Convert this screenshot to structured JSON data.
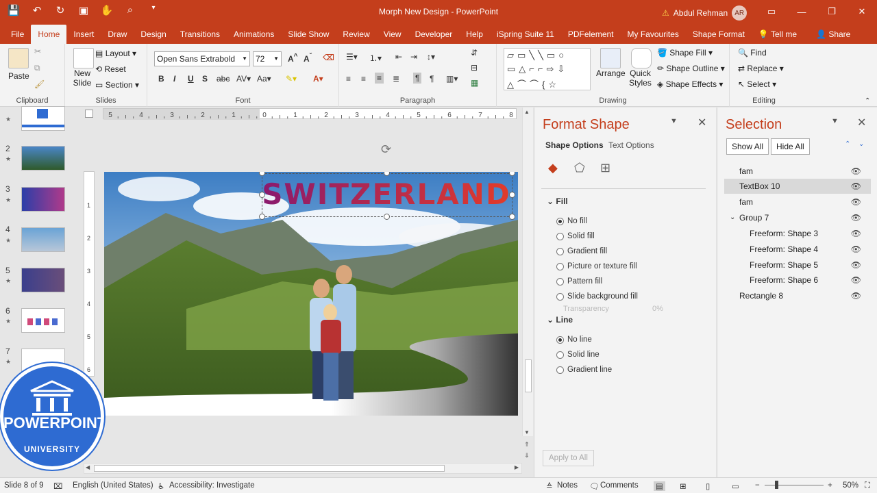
{
  "window": {
    "title": "Morph New Design  -  PowerPoint",
    "user_name": "Abdul Rehman",
    "user_initials": "AR"
  },
  "tabs": [
    "File",
    "Home",
    "Insert",
    "Draw",
    "Design",
    "Transitions",
    "Animations",
    "Slide Show",
    "Review",
    "View",
    "Developer",
    "Help",
    "iSpring Suite 11",
    "PDFelement",
    "My Favourites",
    "Shape Format"
  ],
  "tell_me": "Tell me",
  "share": "Share",
  "ribbon": {
    "clipboard": {
      "label": "Clipboard",
      "paste": "Paste"
    },
    "slides": {
      "label": "Slides",
      "new_slide": "New",
      "new_slide2": "Slide",
      "layout": "Layout",
      "reset": "Reset",
      "section": "Section"
    },
    "font": {
      "label": "Font",
      "family": "Open Sans Extrabold",
      "size": "72"
    },
    "paragraph": {
      "label": "Paragraph"
    },
    "drawing": {
      "label": "Drawing",
      "arrange": "Arrange",
      "quick_styles": "Quick",
      "quick_styles2": "Styles",
      "shape_fill": "Shape Fill",
      "shape_outline": "Shape Outline",
      "shape_effects": "Shape Effects"
    },
    "editing": {
      "label": "Editing",
      "find": "Find",
      "replace": "Replace",
      "select": "Select"
    }
  },
  "slides": [
    {
      "num": "",
      "star": "★"
    },
    {
      "num": "2",
      "star": "★"
    },
    {
      "num": "3",
      "star": "★"
    },
    {
      "num": "4",
      "star": "★"
    },
    {
      "num": "5",
      "star": "★"
    },
    {
      "num": "6",
      "star": "★"
    },
    {
      "num": "7",
      "star": "★"
    }
  ],
  "slide_content": {
    "headline": "SWITZERLAND"
  },
  "ruler": {
    "h_ticks": [
      "5",
      "4",
      "3",
      "2",
      "1",
      "0",
      "1",
      "2",
      "3",
      "4",
      "5",
      "6",
      "7",
      "8"
    ],
    "v_ticks": [
      "1",
      "2",
      "3",
      "4",
      "5",
      "6"
    ]
  },
  "format_pane": {
    "title": "Format Shape",
    "tab_shape": "Shape Options",
    "tab_text": "Text Options",
    "fill_head": "Fill",
    "fill_options": [
      "No fill",
      "Solid fill",
      "Gradient fill",
      "Picture or texture fill",
      "Pattern fill",
      "Slide background fill"
    ],
    "line_head": "Line",
    "line_options": [
      "No line",
      "Solid line",
      "Gradient line"
    ],
    "transparency": "Transparency",
    "transparency_value": "0%",
    "apply_all": "Apply to All"
  },
  "selection_pane": {
    "title": "Selection",
    "show_all": "Show All",
    "hide_all": "Hide All",
    "items": [
      {
        "label": "fam",
        "indent": 0,
        "selected": false
      },
      {
        "label": "TextBox 10",
        "indent": 0,
        "selected": true
      },
      {
        "label": "fam",
        "indent": 0,
        "selected": false
      },
      {
        "label": "Group 7",
        "indent": 0,
        "selected": false,
        "group": true
      },
      {
        "label": "Freeform: Shape 3",
        "indent": 1,
        "selected": false
      },
      {
        "label": "Freeform: Shape 4",
        "indent": 1,
        "selected": false
      },
      {
        "label": "Freeform: Shape 5",
        "indent": 1,
        "selected": false
      },
      {
        "label": "Freeform: Shape 6",
        "indent": 1,
        "selected": false
      },
      {
        "label": "Rectangle 8",
        "indent": 0,
        "selected": false
      }
    ]
  },
  "statusbar": {
    "slide": "Slide 8 of 9",
    "language": "English (United States)",
    "accessibility": "Accessibility: Investigate",
    "notes": "Notes",
    "comments": "Comments",
    "zoom": "50%"
  },
  "logo": {
    "line1": "POWERPOINT",
    "line2": "UNIVERSITY"
  },
  "colors": {
    "accent": "#c43e1c",
    "headline_from": "#8a1a6e",
    "headline_to": "#e23b2a"
  }
}
